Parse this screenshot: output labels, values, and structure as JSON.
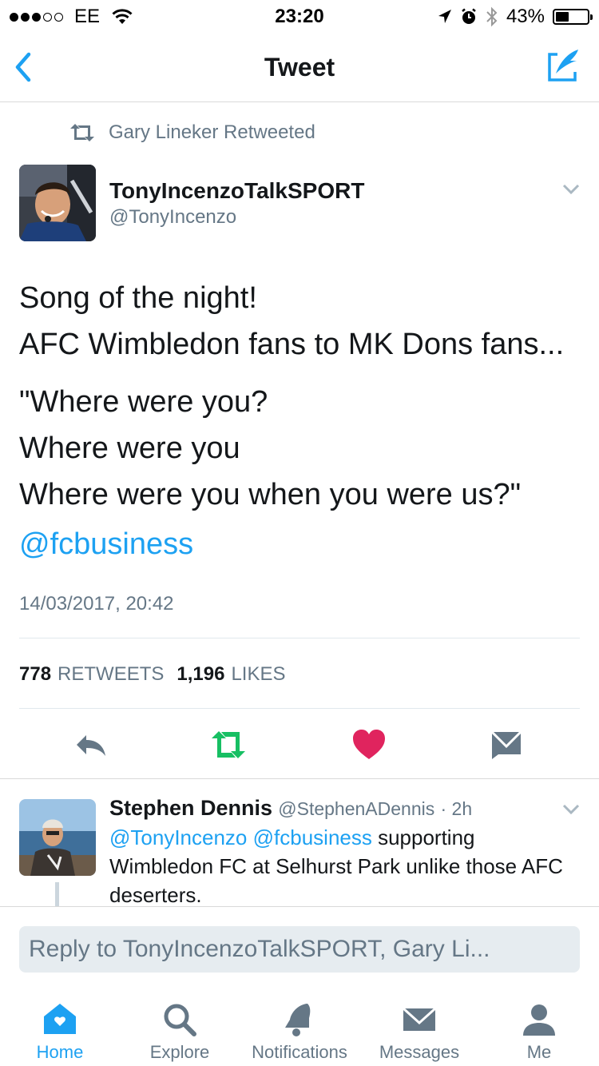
{
  "status_bar": {
    "carrier": "EE",
    "time": "23:20",
    "battery": "43%",
    "battery_level": 0.43
  },
  "nav": {
    "title": "Tweet"
  },
  "tweet": {
    "retweet_context": "Gary Lineker Retweeted",
    "author_name": "TonyIncenzoTalkSPORT",
    "author_handle": "@TonyIncenzo",
    "lines_para1": [
      "Song of the night!",
      "AFC Wimbledon fans to MK Dons fans..."
    ],
    "lines_para2": [
      "\"Where were you?",
      "Where were you",
      "Where were you when you were us?\""
    ],
    "mention": "@fcbusiness",
    "date": "14/03/2017, 20:42",
    "retweets_count": "778",
    "retweets_label": "RETWEETS",
    "likes_count": "1,196",
    "likes_label": "LIKES"
  },
  "reply": {
    "name": "Stephen Dennis",
    "handle": "@StephenADennis",
    "time": "· 2h",
    "mention1": "@TonyIncenzo",
    "mention2": "@fcbusiness",
    "text": " supporting Wimbledon FC at Selhurst Park unlike those AFC deserters."
  },
  "composer": {
    "placeholder": "Reply to TonyIncenzoTalkSPORT, Gary Li..."
  },
  "tabs": [
    {
      "label": "Home",
      "icon": "home-icon",
      "active": true
    },
    {
      "label": "Explore",
      "icon": "search-icon",
      "active": false
    },
    {
      "label": "Notifications",
      "icon": "bell-icon",
      "active": false
    },
    {
      "label": "Messages",
      "icon": "envelope-icon",
      "active": false
    },
    {
      "label": "Me",
      "icon": "person-icon",
      "active": false
    }
  ],
  "colors": {
    "accent": "#1da1f2",
    "retweet_green": "#17bf63",
    "like_red": "#e0245e",
    "muted": "#657786"
  }
}
